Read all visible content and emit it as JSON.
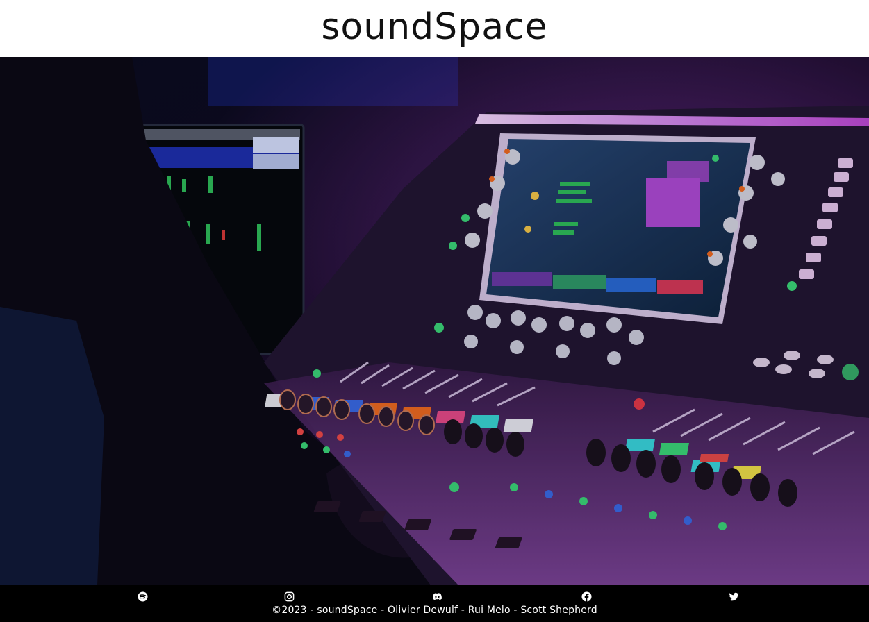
{
  "header": {
    "title": "soundSpace"
  },
  "hero": {
    "image": "mixing-console-photo",
    "accent_colors": [
      "#c04ad8",
      "#7a2aa0",
      "#1c1e6e",
      "#f06a22",
      "#3cd67a"
    ]
  },
  "footer": {
    "social": [
      {
        "name": "spotify",
        "icon": "spotify-icon"
      },
      {
        "name": "instagram",
        "icon": "instagram-icon"
      },
      {
        "name": "discord",
        "icon": "discord-icon"
      },
      {
        "name": "facebook",
        "icon": "facebook-icon"
      },
      {
        "name": "twitter",
        "icon": "twitter-icon"
      }
    ],
    "copyright": "©2023 - soundSpace - Olivier Dewulf - Rui Melo - Scott Shepherd"
  }
}
